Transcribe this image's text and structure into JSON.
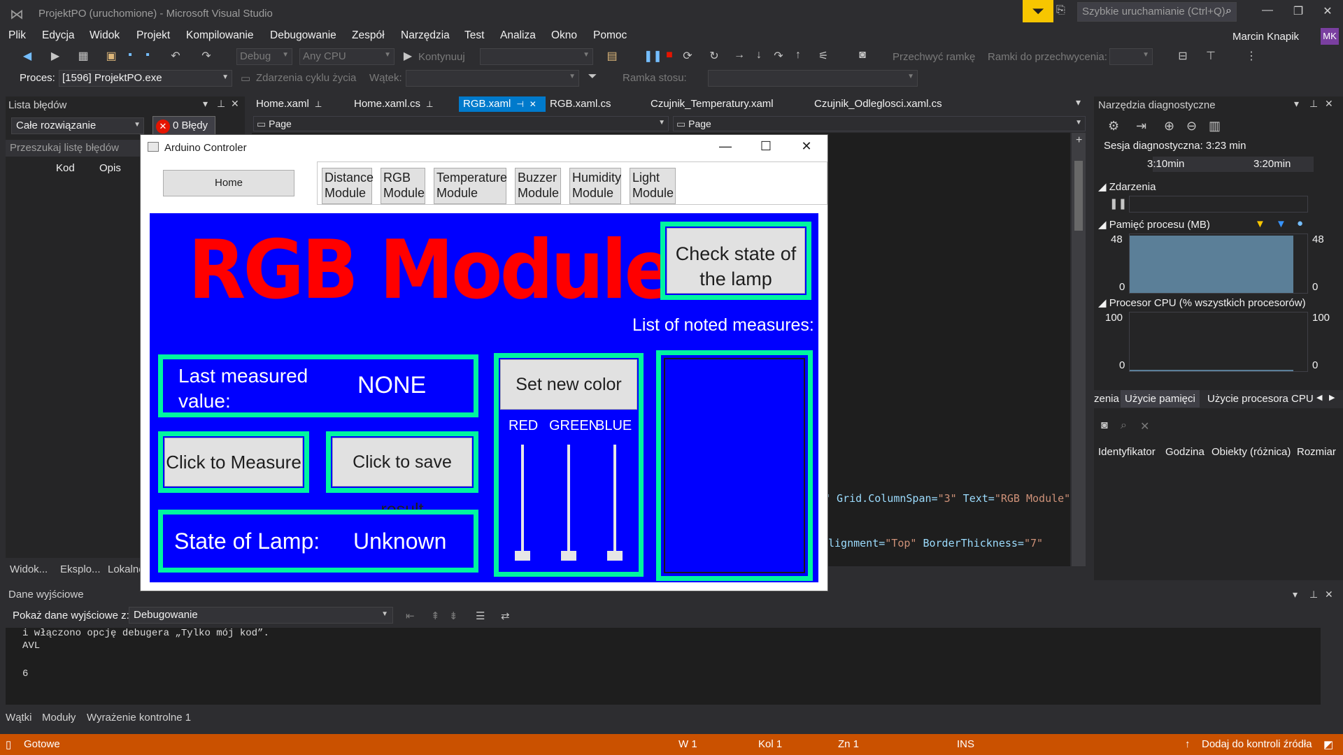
{
  "window": {
    "title": "ProjektPO (uruchomione) - Microsoft Visual Studio",
    "quick_launch_placeholder": "Szybkie uruchamianie (Ctrl+Q)",
    "user": "Marcin Knapik",
    "avatar_initials": "MK"
  },
  "menu": [
    "Plik",
    "Edycja",
    "Widok",
    "Projekt",
    "Kompilowanie",
    "Debugowanie",
    "Zespół",
    "Narzędzia",
    "Test",
    "Analiza",
    "Okno",
    "Pomoc"
  ],
  "toolbar": {
    "config": "Debug",
    "platform": "Any CPU",
    "continue_label": "Kontynuuj",
    "capture_frame": "Przechwyć ramkę",
    "frames_to_capture": "Ramki do przechwycenia:"
  },
  "process_bar": {
    "label": "Proces:",
    "process": "[1596] ProjektPO.exe",
    "lifecycle_events": "Zdarzenia cyklu życia",
    "thread_label": "Wątek:",
    "stack_frame_label": "Ramka stosu:"
  },
  "error_list": {
    "title": "Lista błędów",
    "scope": "Całe rozwiązanie",
    "errors_button": "0 Błędy",
    "search_placeholder": "Przeszukaj listę błędów",
    "col_code": "Kod",
    "col_desc": "Opis",
    "bottom_tabs": [
      "Widok...",
      "Eksplo...",
      "Lokalne"
    ]
  },
  "doc_tabs": [
    {
      "label": "Home.xaml",
      "active": false
    },
    {
      "label": "Home.xaml.cs",
      "active": false
    },
    {
      "label": "RGB.xaml",
      "active": true
    },
    {
      "label": "RGB.xaml.cs",
      "active": false
    },
    {
      "label": "Czujnik_Temperatury.xaml",
      "active": false
    },
    {
      "label": "Czujnik_Odleglosci.xaml.cs",
      "active": false
    }
  ],
  "nav": {
    "left": "Page",
    "right": "Page"
  },
  "code": {
    "line1_a": "\" Grid.ColumnSpan=",
    "line1_b": "\"3\"",
    "line1_c": " Text=",
    "line1_d": "\"RGB Module\"",
    "line2_a": "lignment=",
    "line2_b": "\"Top\"",
    "line2_c": " BorderThickness=",
    "line2_d": "\"7\""
  },
  "diagnostics": {
    "title": "Narzędzia diagnostyczne",
    "session": "Sesja diagnostyczna: 3:23 min",
    "tick1": "3:10min",
    "tick2": "3:20min",
    "events": "Zdarzenia",
    "memory": "Pamięć procesu (MB)",
    "mem_max": "48",
    "mem_min": "0",
    "cpu": "Procesor CPU (% wszystkich procesorów)",
    "cpu_max": "100",
    "cpu_min": "0",
    "tabs": [
      "zenia",
      "Użycie pamięci",
      "Użycie procesora CPU"
    ],
    "columns": [
      "Identyfikator",
      "Godzina",
      "Obiekty (różnica)",
      "Rozmiar"
    ]
  },
  "output": {
    "title": "Dane wyjściowe",
    "show_label": "Pokaż dane wyjściowe z:",
    "source": "Debugowanie",
    "lines": [
      "  i włączono opcję debugera „Tylko mój kod”.",
      "AVL",
      "",
      "6"
    ]
  },
  "bottom_tabs": [
    "Wątki",
    "Moduły",
    "Wyrażenie kontrolne 1"
  ],
  "status": {
    "ready": "Gotowe",
    "line": "W 1",
    "col": "Kol 1",
    "ch": "Zn 1",
    "ins": "INS",
    "source_control": "Dodaj do kontroli źródła"
  },
  "app": {
    "title": "Arduino Controler",
    "home": "Home",
    "modules": [
      {
        "l1": "Distance",
        "l2": "Module"
      },
      {
        "l1": "RGB",
        "l2": "Module"
      },
      {
        "l1": "Temperature",
        "l2": "Module"
      },
      {
        "l1": "Buzzer",
        "l2": "Module"
      },
      {
        "l1": "Humidity",
        "l2": "Module"
      },
      {
        "l1": "Light",
        "l2": "Module"
      }
    ],
    "heading": "RGB Module",
    "check_state": "Check state of the lamp",
    "list_label": "List of noted measures:",
    "last_measured": "Last measured value:",
    "last_value": "NONE",
    "set_color": "Set new color",
    "red": "RED",
    "green": "GREEN",
    "blue": "BLUE",
    "click_measure": "Click to Measure",
    "click_save": "Click to save result",
    "state_label": "State of Lamp:",
    "state_value": "Unknown",
    "colors": {
      "panel": "#0000ff",
      "border": "#00f5a0",
      "heading": "#ff0000"
    }
  }
}
